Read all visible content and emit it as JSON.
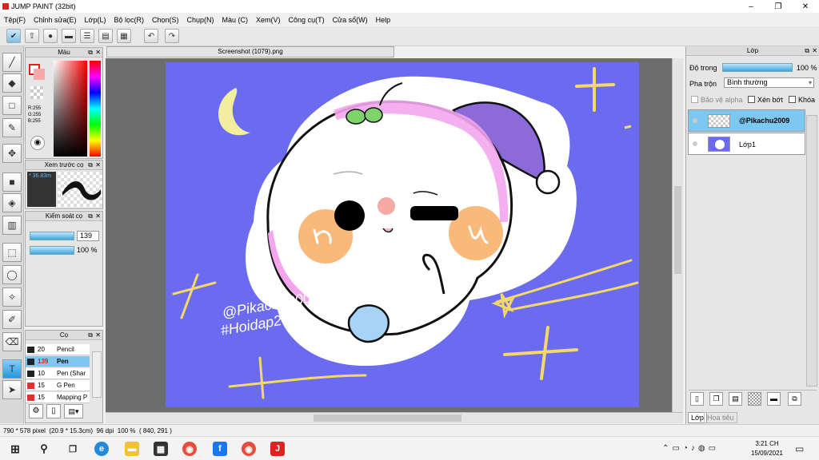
{
  "window": {
    "title": "JUMP PAINT (32bit)",
    "controls": [
      "–",
      "❐",
      "✕"
    ]
  },
  "menu": [
    "Tệp(F)",
    "Chỉnh sửa(E)",
    "Lớp(L)",
    "Bộ lọc(R)",
    "Chọn(S)",
    "Chụp(N)",
    "Màu (C)",
    "Xem(V)",
    "Công cụ(T)",
    "Cửa sổ(W)",
    "Help"
  ],
  "document": {
    "tab_title": "Screenshot (1079).png"
  },
  "color_panel": {
    "title": "Màu",
    "r": "R:255",
    "g": "G:255",
    "b": "B:255"
  },
  "brush_preview": {
    "title": "Xem trước cọ",
    "size": "* 36.83m"
  },
  "brush_control": {
    "title": "Kiểm soát cọ",
    "size_value": "139",
    "opacity_value": "100 %"
  },
  "brush_list": {
    "title": "Cọ",
    "items": [
      {
        "size": "20",
        "name": "Pencil",
        "color": "#222222"
      },
      {
        "size": "139",
        "name": "Pen",
        "color": "#222222",
        "selected": true
      },
      {
        "size": "10",
        "name": "Pen (Shar",
        "color": "#222222"
      },
      {
        "size": "15",
        "name": "G Pen",
        "color": "#e03030"
      },
      {
        "size": "15",
        "name": "Mapping P",
        "color": "#e03030"
      }
    ]
  },
  "layer_panel": {
    "title": "Lớp",
    "opacity_label": "Độ trong",
    "opacity_value": "100 %",
    "blend_label": "Pha trộn",
    "blend_value": "Bình thường",
    "protect_alpha": "Bảo vệ alpha",
    "clip": "Xén bớt",
    "lock": "Khóa",
    "layers": [
      {
        "name": "@Pikachu2009",
        "selected": true
      },
      {
        "name": "Lớp1",
        "selected": false
      }
    ],
    "tabs": [
      "Lớp",
      "Hoa tiêu"
    ]
  },
  "artwork": {
    "watermark_line1": "@Pikachu2009",
    "watermark_line2": "#Hoidap247"
  },
  "status": {
    "size": "790 * 578 pixel",
    "cm": "(20.9 * 15.3cm)",
    "dpi": "96 dpi",
    "zoom": "100 %",
    "coords": "( 840, 291 )"
  },
  "taskbar": {
    "time": "3:21 CH",
    "date": "15/09/2021"
  },
  "colors": {
    "canvas_bg": "#6b6bf0",
    "selected_layer": "#7cc8f2",
    "accent_bar": "#3fa4e0"
  }
}
